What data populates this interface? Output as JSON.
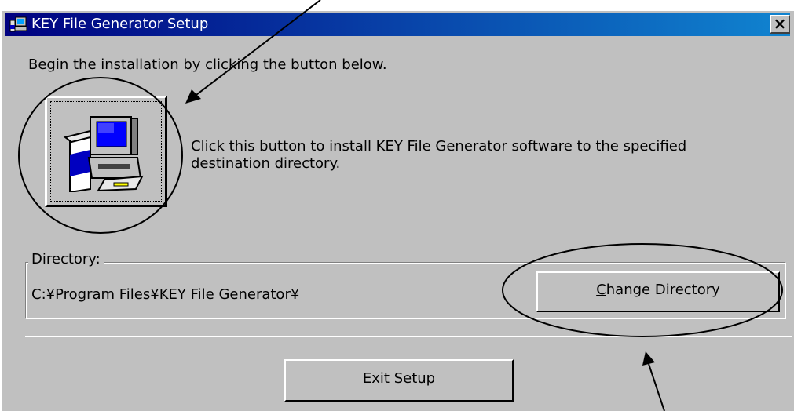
{
  "window": {
    "title": "KEY File Generator Setup",
    "close_symbol": "×"
  },
  "main": {
    "instruction": "Begin the installation by clicking the button below.",
    "install_description_line1": "Click this button to install KEY File Generator software to the specified",
    "install_description_line2": "destination directory."
  },
  "directory": {
    "group_label": "Directory:",
    "path": "C:¥Program Files¥KEY File Generator¥",
    "change_button": {
      "mnemonic": "C",
      "rest": "hange Directory"
    }
  },
  "exit_button": {
    "before": "E",
    "mnemonic": "x",
    "after": "it Setup"
  },
  "icons": [
    "setup-app-icon",
    "computer-install-icon",
    "close-icon"
  ],
  "colors": {
    "titlebar_start": "#000080",
    "titlebar_end": "#1084d0",
    "window_bg": "#c0c0c0"
  }
}
